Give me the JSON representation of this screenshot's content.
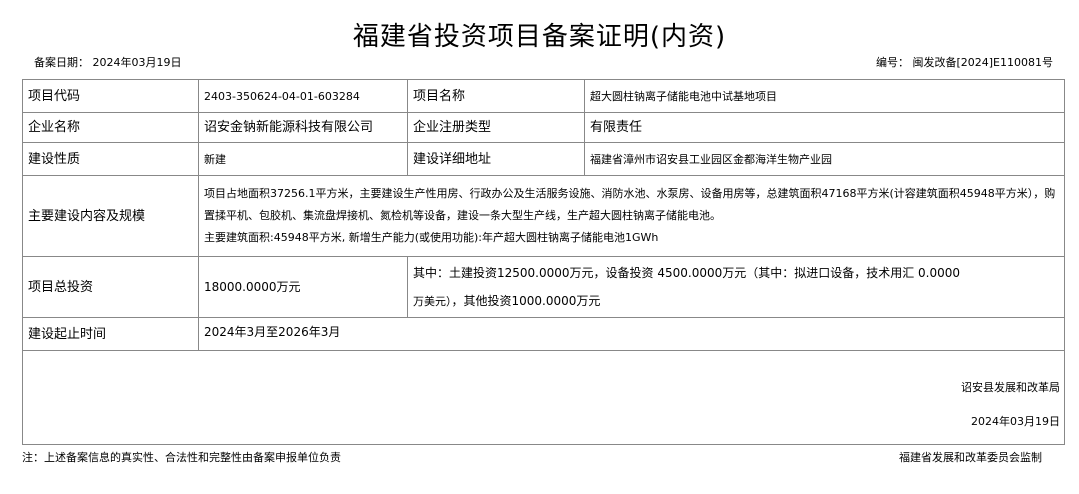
{
  "document": {
    "title": "福建省投资项目备案证明(内资)",
    "filing_date": "备案日期： 2024年03月19日",
    "serial_no": "编号： 闽发改备[2024]E110081号"
  },
  "rows": {
    "project_code_label": "项目代码",
    "project_code": "2403-350624-04-01-603284",
    "project_name_label": "项目名称",
    "project_name": "超大圆柱钠离子储能电池中试基地项目",
    "company_label": "企业名称",
    "company": "诏安金钠新能源科技有限公司",
    "reg_type_label": "企业注册类型",
    "reg_type": "有限责任",
    "nature_label": "建设性质",
    "nature": "新建",
    "address_label": "建设详细地址",
    "address": "福建省漳州市诏安县工业园区金都海洋生物产业园",
    "scope_label": "主要建设内容及规模",
    "scope_text": "项目占地面积37256.1平方米，主要建设生产性用房、行政办公及生活服务设施、消防水池、水泵房、设备用房等，总建筑面积47168平方米(计容建筑面积45948平方米），购置揉平机、包胶机、集流盘焊接机、氮检机等设备，建设一条大型生产线，生产超大圆柱钠离子储能电池。",
    "scope_area": "主要建筑面积:45948平方米, 新增生产能力(或使用功能):年产超大圆柱钠离子储能电池1GWh",
    "investment_label": "项目总投资",
    "investment_total": "18000.0000万元",
    "investment_detail_line1": "其中：土建投资12500.0000万元，设备投资 4500.0000万元（其中：拟进口设备，技术用汇 0.0000",
    "investment_detail_line2_small": "万美元）",
    "investment_detail_line2_rest": "，其他投资1000.0000万元",
    "period_label": "建设起止时间",
    "period": "2024年3月至2026年3月"
  },
  "footer": {
    "authority": "诏安县发展和改革局",
    "issue_date": "2024年03月19日",
    "disclaimer": "注：上述备案信息的真实性、合法性和完整性由备案申报单位负责",
    "supervision": "福建省发展和改革委员会监制"
  }
}
